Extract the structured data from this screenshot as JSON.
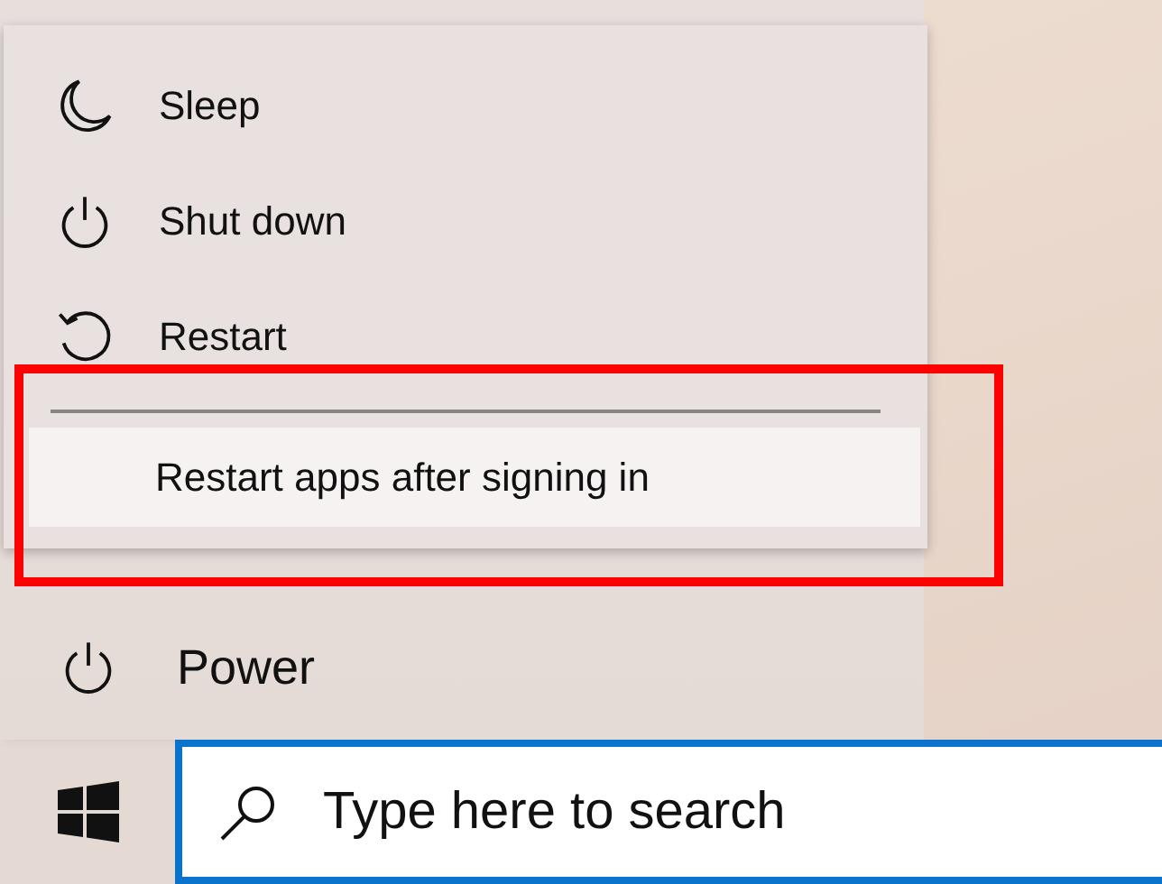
{
  "power_menu": {
    "items": [
      {
        "label": "Sleep",
        "kind": "command",
        "highlighted": false
      },
      {
        "label": "Shut down",
        "kind": "command",
        "highlighted": false
      },
      {
        "label": "Restart",
        "kind": "command",
        "highlighted": false
      },
      {
        "label": "Restart apps after signing in",
        "kind": "option",
        "highlighted": true
      }
    ]
  },
  "power_button": {
    "label": "Power"
  },
  "taskbar": {
    "search": {
      "placeholder": "Type here to search"
    }
  }
}
